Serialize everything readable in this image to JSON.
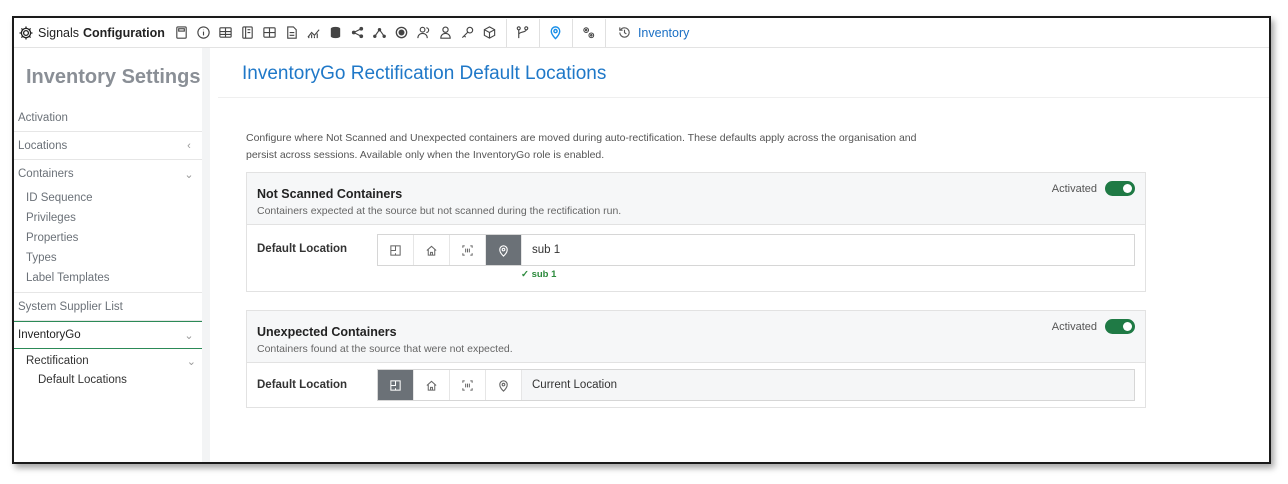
{
  "topbar": {
    "brand_1": "Signals",
    "brand_2": "Configuration",
    "history_label": "Inventory",
    "icons": [
      "calculator-icon",
      "info-icon",
      "table-icon",
      "notebook-icon",
      "grid-icon",
      "document-icon",
      "chart-icon",
      "database-icon",
      "share-icon",
      "network-icon",
      "badge-icon",
      "user-group-icon",
      "user-icon",
      "key-icon",
      "cube-icon",
      "branch-icon",
      "location-pin-icon",
      "settings-gears-icon",
      "history-icon"
    ]
  },
  "sidebar": {
    "title": "Inventory Settings",
    "items": {
      "activation": "Activation",
      "locations": "Locations",
      "containers": "Containers",
      "id_sequence": "ID Sequence",
      "privileges": "Privileges",
      "properties": "Properties",
      "types": "Types",
      "label_templates": "Label Templates",
      "system_supplier_list": "System Supplier List",
      "inventorygo": "InventoryGo",
      "rectification": "Rectification",
      "default_locations": "Default Locations"
    }
  },
  "main": {
    "title": "InventoryGo Rectification Default Locations",
    "description_line1": "Configure where Not Scanned and Unexpected containers are moved during auto-rectification. These defaults apply across the organisation and",
    "description_line2": "persist across sessions. Available only when the InventoryGo role is enabled.",
    "cards": [
      {
        "title": "Not Scanned Containers",
        "subtitle": "Containers expected at the source but not scanned during the rectification run.",
        "toggle_label": "Activated",
        "row_label": "Default Location",
        "value": "sub 1",
        "validation": "✓ sub 1"
      },
      {
        "title": "Unexpected Containers",
        "subtitle": "Containers found at the source that were not expected.",
        "toggle_label": "Activated",
        "row_label": "Default Location",
        "value": "Current Location"
      }
    ]
  },
  "colors": {
    "accent": "#1f78c8",
    "toggle_on": "#1f7a45",
    "valid": "#2c8a3c",
    "selected_btn": "#6b7177"
  }
}
